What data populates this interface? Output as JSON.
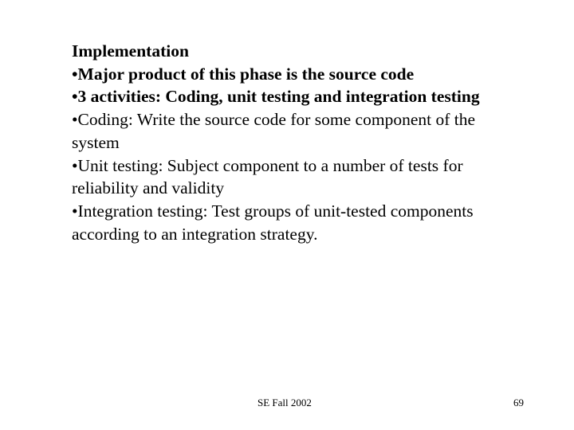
{
  "slide": {
    "title": "Implementation",
    "bullet_char": "•",
    "bullets": [
      {
        "lines": [
          "Major product of this phase is the source code"
        ],
        "bold": true
      },
      {
        "lines": [
          "3 activities: Coding, unit testing and integration testing"
        ],
        "bold": true
      },
      {
        "lines": [
          "Coding: Write the source code for some component of the",
          "system"
        ],
        "bold": false
      },
      {
        "lines": [
          "Unit testing: Subject component to a number of tests for",
          "reliability and validity"
        ],
        "bold": false
      },
      {
        "lines": [
          "Integration testing: Test groups of unit-tested components",
          "according to an integration strategy."
        ],
        "bold": false
      }
    ]
  },
  "footer": {
    "course": "SE Fall 2002",
    "page_number": "69"
  }
}
